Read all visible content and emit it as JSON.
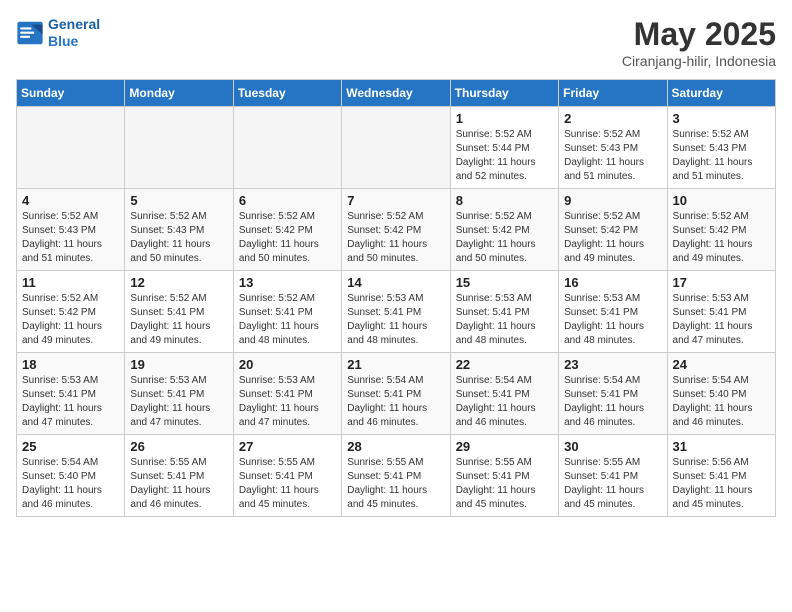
{
  "logo": {
    "line1": "General",
    "line2": "Blue"
  },
  "title": "May 2025",
  "subtitle": "Ciranjang-hilir, Indonesia",
  "days_of_week": [
    "Sunday",
    "Monday",
    "Tuesday",
    "Wednesday",
    "Thursday",
    "Friday",
    "Saturday"
  ],
  "weeks": [
    [
      {
        "day": "",
        "info": ""
      },
      {
        "day": "",
        "info": ""
      },
      {
        "day": "",
        "info": ""
      },
      {
        "day": "",
        "info": ""
      },
      {
        "day": "1",
        "info": "Sunrise: 5:52 AM\nSunset: 5:44 PM\nDaylight: 11 hours\nand 52 minutes."
      },
      {
        "day": "2",
        "info": "Sunrise: 5:52 AM\nSunset: 5:43 PM\nDaylight: 11 hours\nand 51 minutes."
      },
      {
        "day": "3",
        "info": "Sunrise: 5:52 AM\nSunset: 5:43 PM\nDaylight: 11 hours\nand 51 minutes."
      }
    ],
    [
      {
        "day": "4",
        "info": "Sunrise: 5:52 AM\nSunset: 5:43 PM\nDaylight: 11 hours\nand 51 minutes."
      },
      {
        "day": "5",
        "info": "Sunrise: 5:52 AM\nSunset: 5:43 PM\nDaylight: 11 hours\nand 50 minutes."
      },
      {
        "day": "6",
        "info": "Sunrise: 5:52 AM\nSunset: 5:42 PM\nDaylight: 11 hours\nand 50 minutes."
      },
      {
        "day": "7",
        "info": "Sunrise: 5:52 AM\nSunset: 5:42 PM\nDaylight: 11 hours\nand 50 minutes."
      },
      {
        "day": "8",
        "info": "Sunrise: 5:52 AM\nSunset: 5:42 PM\nDaylight: 11 hours\nand 50 minutes."
      },
      {
        "day": "9",
        "info": "Sunrise: 5:52 AM\nSunset: 5:42 PM\nDaylight: 11 hours\nand 49 minutes."
      },
      {
        "day": "10",
        "info": "Sunrise: 5:52 AM\nSunset: 5:42 PM\nDaylight: 11 hours\nand 49 minutes."
      }
    ],
    [
      {
        "day": "11",
        "info": "Sunrise: 5:52 AM\nSunset: 5:42 PM\nDaylight: 11 hours\nand 49 minutes."
      },
      {
        "day": "12",
        "info": "Sunrise: 5:52 AM\nSunset: 5:41 PM\nDaylight: 11 hours\nand 49 minutes."
      },
      {
        "day": "13",
        "info": "Sunrise: 5:52 AM\nSunset: 5:41 PM\nDaylight: 11 hours\nand 48 minutes."
      },
      {
        "day": "14",
        "info": "Sunrise: 5:53 AM\nSunset: 5:41 PM\nDaylight: 11 hours\nand 48 minutes."
      },
      {
        "day": "15",
        "info": "Sunrise: 5:53 AM\nSunset: 5:41 PM\nDaylight: 11 hours\nand 48 minutes."
      },
      {
        "day": "16",
        "info": "Sunrise: 5:53 AM\nSunset: 5:41 PM\nDaylight: 11 hours\nand 48 minutes."
      },
      {
        "day": "17",
        "info": "Sunrise: 5:53 AM\nSunset: 5:41 PM\nDaylight: 11 hours\nand 47 minutes."
      }
    ],
    [
      {
        "day": "18",
        "info": "Sunrise: 5:53 AM\nSunset: 5:41 PM\nDaylight: 11 hours\nand 47 minutes."
      },
      {
        "day": "19",
        "info": "Sunrise: 5:53 AM\nSunset: 5:41 PM\nDaylight: 11 hours\nand 47 minutes."
      },
      {
        "day": "20",
        "info": "Sunrise: 5:53 AM\nSunset: 5:41 PM\nDaylight: 11 hours\nand 47 minutes."
      },
      {
        "day": "21",
        "info": "Sunrise: 5:54 AM\nSunset: 5:41 PM\nDaylight: 11 hours\nand 46 minutes."
      },
      {
        "day": "22",
        "info": "Sunrise: 5:54 AM\nSunset: 5:41 PM\nDaylight: 11 hours\nand 46 minutes."
      },
      {
        "day": "23",
        "info": "Sunrise: 5:54 AM\nSunset: 5:41 PM\nDaylight: 11 hours\nand 46 minutes."
      },
      {
        "day": "24",
        "info": "Sunrise: 5:54 AM\nSunset: 5:40 PM\nDaylight: 11 hours\nand 46 minutes."
      }
    ],
    [
      {
        "day": "25",
        "info": "Sunrise: 5:54 AM\nSunset: 5:40 PM\nDaylight: 11 hours\nand 46 minutes."
      },
      {
        "day": "26",
        "info": "Sunrise: 5:55 AM\nSunset: 5:41 PM\nDaylight: 11 hours\nand 46 minutes."
      },
      {
        "day": "27",
        "info": "Sunrise: 5:55 AM\nSunset: 5:41 PM\nDaylight: 11 hours\nand 45 minutes."
      },
      {
        "day": "28",
        "info": "Sunrise: 5:55 AM\nSunset: 5:41 PM\nDaylight: 11 hours\nand 45 minutes."
      },
      {
        "day": "29",
        "info": "Sunrise: 5:55 AM\nSunset: 5:41 PM\nDaylight: 11 hours\nand 45 minutes."
      },
      {
        "day": "30",
        "info": "Sunrise: 5:55 AM\nSunset: 5:41 PM\nDaylight: 11 hours\nand 45 minutes."
      },
      {
        "day": "31",
        "info": "Sunrise: 5:56 AM\nSunset: 5:41 PM\nDaylight: 11 hours\nand 45 minutes."
      }
    ]
  ]
}
